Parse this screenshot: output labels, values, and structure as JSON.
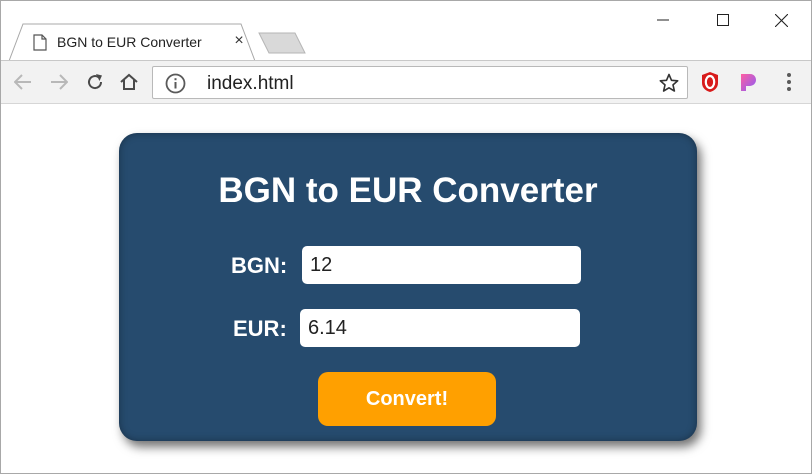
{
  "browser": {
    "tab_title": "BGN to EUR Converter",
    "tab_close_glyph": "×",
    "url": "index.html",
    "icons": [
      "document-icon",
      "close-icon",
      "back-icon",
      "forward-icon",
      "reload-icon",
      "home-icon",
      "info-icon",
      "star-icon",
      "opera-extension-icon",
      "pocket-extension-icon",
      "menu-icon",
      "minimize-icon",
      "maximize-icon",
      "window-close-icon"
    ]
  },
  "converter": {
    "title": "BGN to EUR Converter",
    "bgn_label": "BGN:",
    "bgn_value": "12",
    "eur_label": "EUR:",
    "eur_value": "6.14",
    "button_label": "Convert!"
  },
  "colors": {
    "card_background": "#264b6e",
    "button_background": "#ffa000",
    "text": "#ffffff"
  }
}
